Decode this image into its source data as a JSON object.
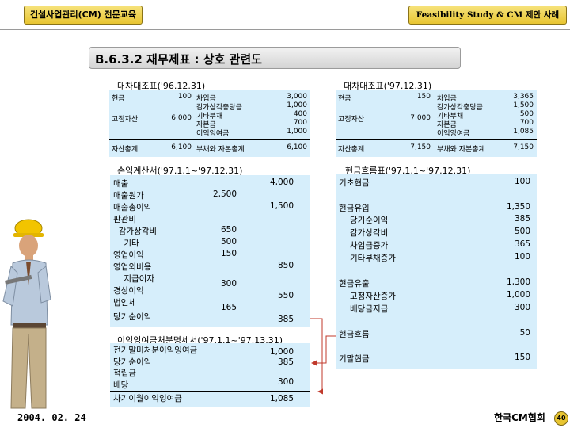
{
  "header": {
    "left_label": "건설사업관리(CM) 전문교육",
    "right_label": "Feasibility Study & CM 제안 사례"
  },
  "title": "B.6.3.2 재무제표 : 상호 관련도",
  "bs96": {
    "heading": "대차대조표('96.12.31)",
    "cash": "현금",
    "cash_val": "100",
    "fixed": "고정자산",
    "fixed_val": "6,000",
    "liab_lines": [
      "차입금",
      "감가상각충당금",
      "기타부채",
      "자본금",
      "이익잉여금"
    ],
    "liab_vals": [
      "3,000",
      "1,000",
      "400",
      "700",
      "1,000"
    ],
    "total_assets": "자산총계",
    "total_assets_val": "6,100",
    "total_le": "부채와 자본총계",
    "total_le_val": "6,100"
  },
  "bs97": {
    "heading": "대차대조표('97.12.31)",
    "cash": "현금",
    "cash_val": "150",
    "fixed": "고정자산",
    "fixed_val": "7,000",
    "liab_lines": [
      "차입금",
      "감가상각충당금",
      "기타부채",
      "자본금",
      "이익잉여금"
    ],
    "liab_vals": [
      "3,365",
      "1,500",
      "500",
      "700",
      "1,085"
    ],
    "total_assets": "자산총계",
    "total_assets_val": "7,150",
    "total_le": "부채와 자본총계",
    "total_le_val": "7,150"
  },
  "income": {
    "heading": "손익계산서('97.1.1~'97.12.31)",
    "labels": [
      "매출",
      "매출원가",
      "매출총이익",
      "판관비",
      "  감가상각비",
      "    기타",
      "영업이익",
      "영업외비용",
      "    지급이자",
      "경상이익",
      "법인세"
    ],
    "col1": [
      {
        "row": 1,
        "v": "2,500"
      },
      {
        "row": 4,
        "v": "650"
      },
      {
        "row": 5,
        "v": "500"
      },
      {
        "row": 6,
        "v": "150"
      },
      {
        "row": 8.5,
        "v": "300"
      },
      {
        "row": 10.5,
        "v": "165"
      }
    ],
    "col2": [
      {
        "row": 0,
        "v": "4,000"
      },
      {
        "row": 2,
        "v": "1,500"
      },
      {
        "row": 7,
        "v": "850"
      },
      {
        "row": 9.5,
        "v": "550"
      }
    ],
    "net_label": "당기순이익",
    "net_val": "385"
  },
  "retained": {
    "heading": "이익잉여금처분명세서('97.1.1~'97.13.31)",
    "r1": "전기말미처분이익잉여금",
    "r1v": "1,000",
    "r2": "당기순이익",
    "r2v": "385",
    "r3": "적립금",
    "r4": "배당",
    "r4v": "300",
    "r5": "차기이월이익잉여금",
    "r5v": "1,085"
  },
  "cashflow": {
    "heading": "현금흐름표('97.1.1~'97.12.31)",
    "begin": "기초현금",
    "begin_val": "100",
    "inflow": "현금유입",
    "inflow_val": "1,350",
    "in_items": [
      "당기순이익",
      "감가상각비",
      "차입금증가",
      "기타부채증가"
    ],
    "in_vals": [
      "385",
      "500",
      "365",
      "100"
    ],
    "outflow": "현금유출",
    "outflow_val": "1,300",
    "out_items": [
      "고정자산증가",
      "배당금지급"
    ],
    "out_vals": [
      "1,000",
      "300"
    ],
    "flow": "현금흐름",
    "flow_val": "50",
    "end": "기말현금",
    "end_val": "150"
  },
  "footer": {
    "date": "2004. 02. 24",
    "org": "한국CM협회",
    "page": "40"
  },
  "colors": {
    "panel": "#d6eefb",
    "header_gold": "#e8c531",
    "arrow": "#c0392b"
  }
}
